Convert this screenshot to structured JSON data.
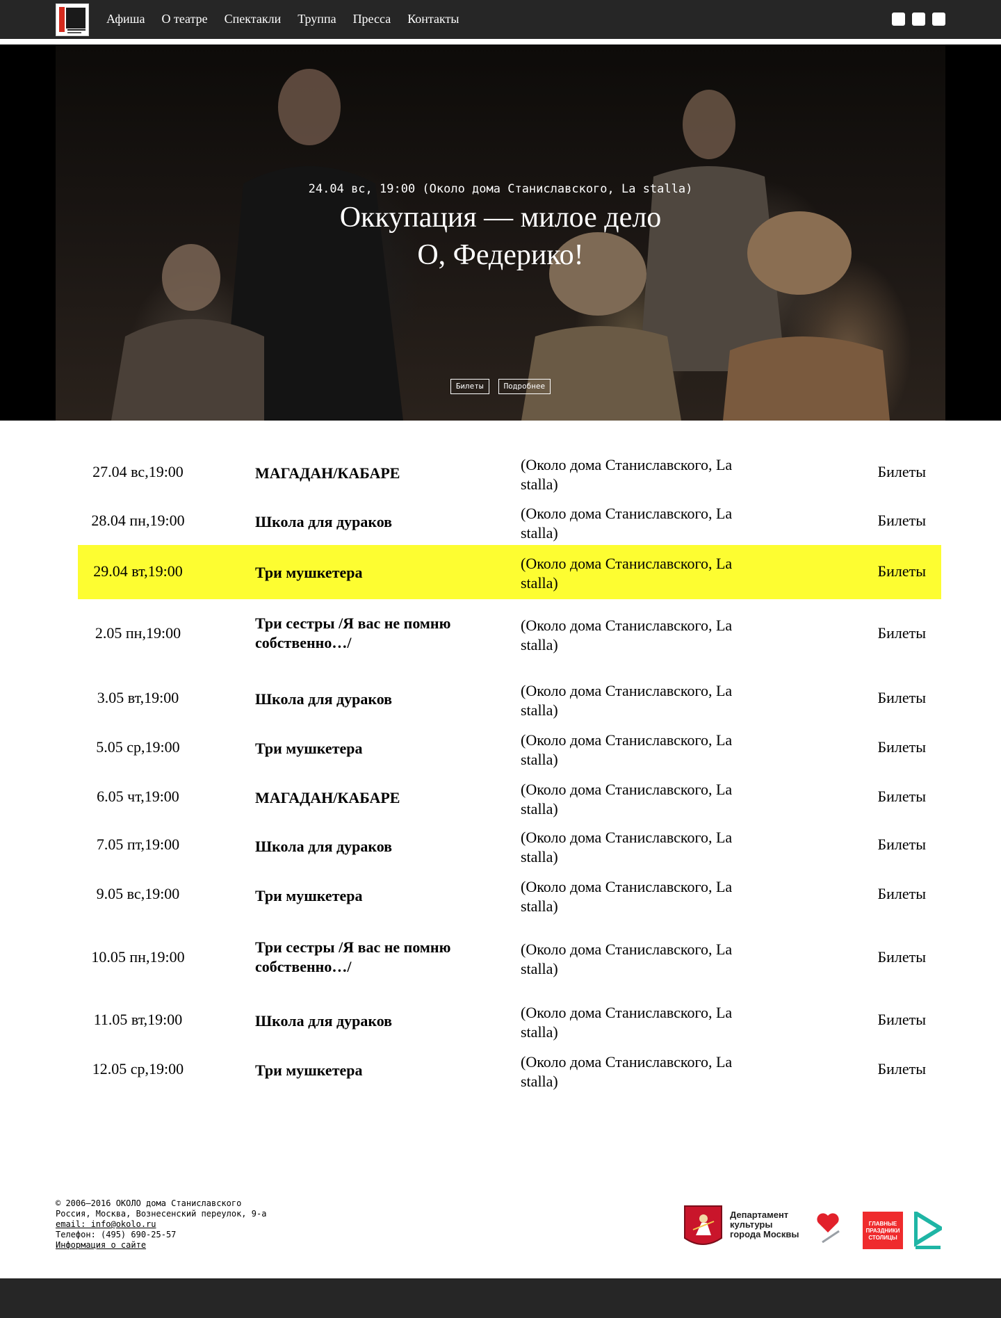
{
  "nav": {
    "items": [
      "Афиша",
      "О театре",
      "Спектакли",
      "Труппа",
      "Пресса",
      "Контакты"
    ]
  },
  "social": [
    "social-icon",
    "social-icon",
    "social-icon"
  ],
  "hero": {
    "meta": "24.04 вс, 19:00 (Около дома Станиславского, La stalla)",
    "title_line1": "Оккупация — милое дело",
    "title_line2": "О, Федерико!",
    "btn_tickets": "Билеты",
    "btn_more": "Подробнее"
  },
  "schedule": [
    {
      "date": "27.04 вс,19:00",
      "title": "МАГАДАН/КАБАРЕ",
      "place": " (Около дома Станиславского, La stalla)",
      "tickets": "Билеты"
    },
    {
      "date": "28.04 пн,19:00",
      "title": "Школа для дураков",
      "place": " (Около дома Станиславского, La stalla)",
      "tickets": "Билеты"
    },
    {
      "date": "29.04 вт,19:00",
      "title": "Три мушкетера",
      "place": " (Около дома Станиславского, La stalla)",
      "tickets": "Билеты",
      "highlight": true
    },
    {
      "date": "2.05 пн,19:00",
      "title": "Три сестры /Я вас не помню собственно…/",
      "place": " (Около дома Станиславского, La stalla)",
      "tickets": "Билеты"
    },
    {
      "date": "3.05 вт,19:00",
      "title": "Школа для дураков",
      "place": " (Около дома Станиславского, La stalla)",
      "tickets": "Билеты"
    },
    {
      "date": "5.05 ср,19:00",
      "title": "Три мушкетера",
      "place": " (Около дома Станиславского, La stalla)",
      "tickets": "Билеты"
    },
    {
      "date": "6.05 чт,19:00",
      "title": "МАГАДАН/КАБАРЕ",
      "place": " (Около дома Станиславского, La stalla)",
      "tickets": "Билеты"
    },
    {
      "date": "7.05 пт,19:00",
      "title": "Школа для дураков",
      "place": " (Около дома Станиславского, La stalla)",
      "tickets": "Билеты"
    },
    {
      "date": "9.05 вс,19:00",
      "title": "Три мушкетера",
      "place": " (Около дома Станиславского, La stalla)",
      "tickets": "Билеты"
    },
    {
      "date": "10.05 пн,19:00",
      "title": "Три сестры /Я вас не помню собственно…/",
      "place": " (Около дома Станиславского, La stalla)",
      "tickets": "Билеты"
    },
    {
      "date": "11.05 вт,19:00",
      "title": "Школа для дураков",
      "place": " (Около дома Станиславского, La stalla)",
      "tickets": "Билеты"
    },
    {
      "date": "12.05 ср,19:00",
      "title": "Три мушкетера",
      "place": " (Около дома Станиславского, La stalla)",
      "tickets": "Билеты"
    }
  ],
  "footer": {
    "copyright": "© 2006–2016 ОКОЛО дома Станиславского",
    "address": "Россия, Москва, Вознесенский переулок, 9-а",
    "email": "email: info@okolo.ru",
    "phone": "Телефон: (495) 690-25-57",
    "about": "Информация о сайте",
    "dept_line1": "Департамент",
    "dept_line2": "культуры",
    "dept_line3": "города Москвы",
    "holiday_line1": "ГЛАВНЫЕ",
    "holiday_line2": "ПРАЗДНИКИ",
    "holiday_line3": "СТОЛИЦЫ"
  },
  "colors": {
    "topbar": "#262626",
    "highlight": "#fdfd31",
    "holiday_red": "#ef2b2d",
    "active_teal": "#1fb5a5"
  }
}
